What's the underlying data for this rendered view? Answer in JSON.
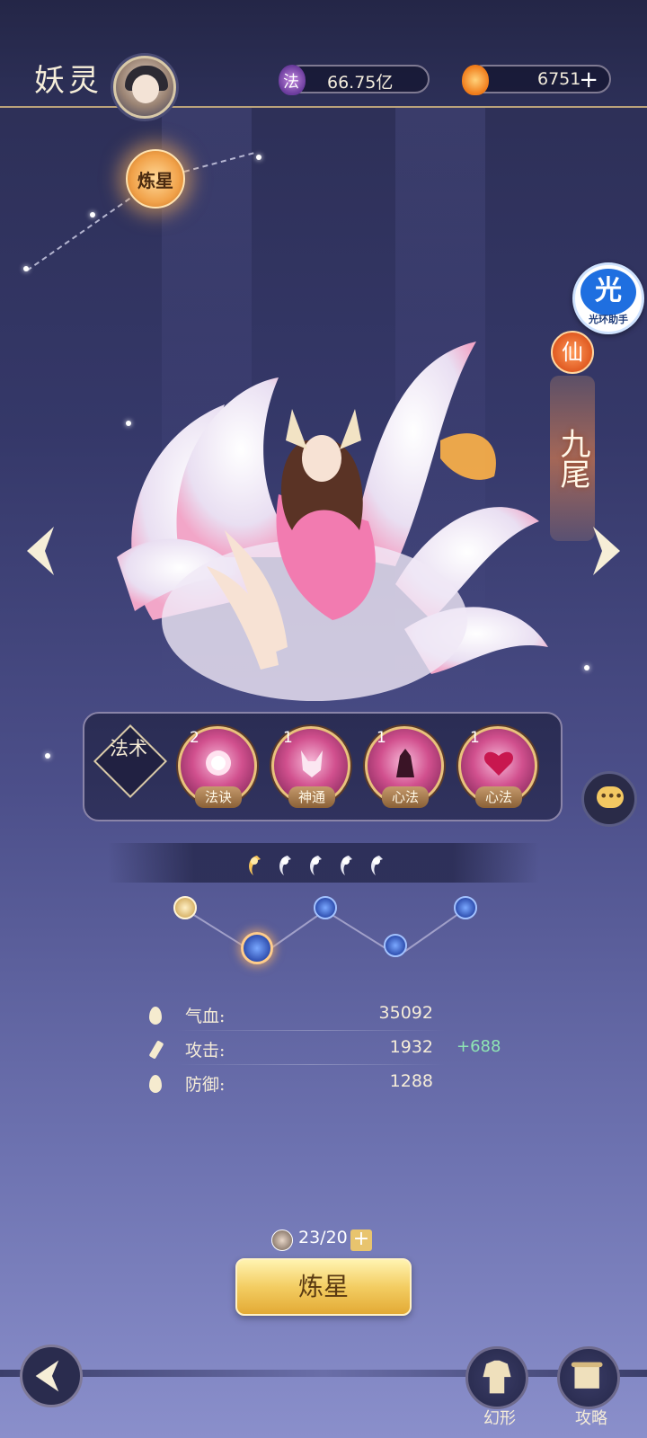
{
  "header": {
    "title": "妖灵",
    "currency_fa": {
      "icon_label": "法",
      "value": "66.75亿"
    },
    "currency_flame": {
      "value": "6751",
      "plus": "+"
    }
  },
  "refine_badge": {
    "label": "炼星"
  },
  "helper": {
    "icon_text": "光",
    "label": "光环助手"
  },
  "character": {
    "rank": "仙",
    "name": "九尾"
  },
  "skills": {
    "title": "法术",
    "items": [
      {
        "level": "2",
        "tag": "法诀",
        "icon": "orb-skill-icon"
      },
      {
        "level": "1",
        "tag": "神通",
        "icon": "fox-skill-icon"
      },
      {
        "level": "1",
        "tag": "心法",
        "icon": "shadow-skill-icon"
      },
      {
        "level": "1",
        "tag": "心法",
        "icon": "heart-skill-icon"
      }
    ]
  },
  "star_progress": {
    "filled": 1,
    "total": 5
  },
  "stats": [
    {
      "label": "气血:",
      "value": "35092",
      "bonus": ""
    },
    {
      "label": "攻击:",
      "value": "1932",
      "bonus": "+688"
    },
    {
      "label": "防御:",
      "value": "1288",
      "bonus": ""
    }
  ],
  "refine": {
    "cost": "23/20",
    "plus": "+",
    "button_label": "炼星"
  },
  "bottom_nav": {
    "skin_label": "幻形",
    "guide_label": "攻略"
  },
  "colors": {
    "accent_gold": "#f3cd62",
    "bonus_green": "#8fe6b4",
    "rank_orange": "#e05a22"
  }
}
